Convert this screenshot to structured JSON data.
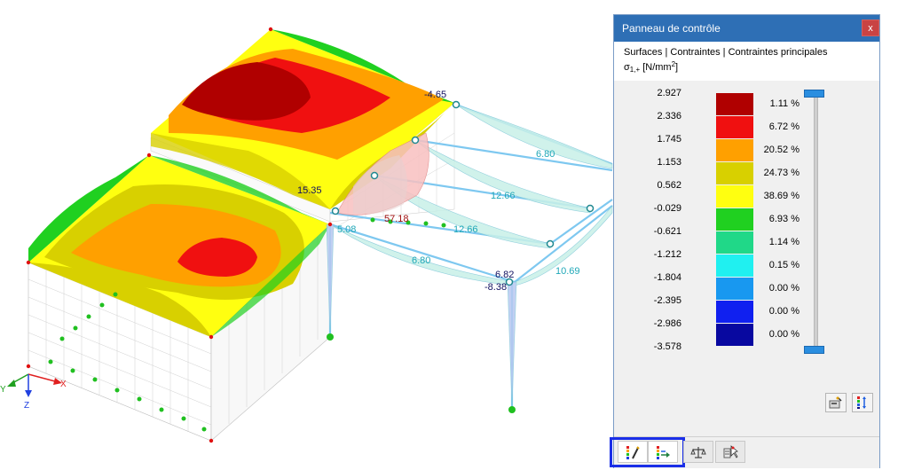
{
  "viewport": {
    "result_labels": [
      "-4.65",
      "15.35",
      "57.18",
      "12.66",
      "6.80",
      "5.08",
      "12.66",
      "6.80",
      "6.82",
      "-8.38",
      "10.69"
    ],
    "axes": {
      "x": "X",
      "y": "Y",
      "z": "Z"
    }
  },
  "panel": {
    "title": "Panneau de contrôle",
    "close_label": "x",
    "path": "Surfaces | Contraintes | Contraintes principales",
    "quantity_symbol": "σ",
    "quantity_subscript": "1,+",
    "quantity_unit_open": " [N/mm",
    "quantity_unit_exp": "2",
    "quantity_unit_close": "]",
    "legend": {
      "values": [
        "2.927",
        "2.336",
        "1.745",
        "1.153",
        "0.562",
        "-0.029",
        "-0.621",
        "-1.212",
        "-1.804",
        "-2.395",
        "-2.986",
        "-3.578"
      ],
      "colors": [
        "#b00000",
        "#f01010",
        "#ffa000",
        "#d8d000",
        "#ffff10",
        "#20d020",
        "#20d888",
        "#20f0f0",
        "#1898f0",
        "#1020f0",
        "#0808a0"
      ],
      "percentages": [
        "1.11 %",
        "6.72 %",
        "20.52 %",
        "24.73 %",
        "38.69 %",
        "6.93 %",
        "1.14 %",
        "0.15 %",
        "0.00 %",
        "0.00 %",
        "0.00 %"
      ]
    },
    "buttons": [
      {
        "icon": "settings-icon"
      },
      {
        "icon": "color-scale-icon"
      }
    ],
    "tabs": [
      {
        "icon": "color-edit-icon",
        "active": true
      },
      {
        "icon": "value-scale-icon",
        "active": false
      },
      {
        "icon": "balance-icon",
        "active": false
      },
      {
        "icon": "cursor-filter-icon",
        "active": false
      }
    ]
  }
}
